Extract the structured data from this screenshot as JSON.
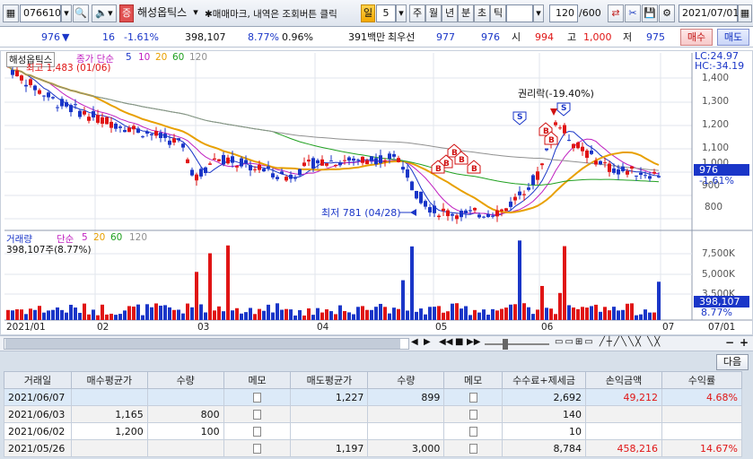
{
  "toolbar": {
    "code": "076610",
    "stock_name": "해성옵틱스",
    "hint": "✱매매마크, 내역은 조회버튼 클릭",
    "period_label": "일",
    "period_value": "5",
    "periods": [
      "주",
      "월",
      "년",
      "분",
      "초",
      "틱"
    ],
    "count": "120",
    "count_max": "/600",
    "date": "2021/07/01"
  },
  "quote": {
    "price": "976",
    "arrow": "▼",
    "change": "16",
    "change_pct": "-1.61%",
    "volume": "398,107",
    "turnover": "8.77%",
    "ratio": "0.96%",
    "amount": "391백만",
    "best_label": "최우선",
    "best_ask": "977",
    "best_bid": "976",
    "open_label": "시",
    "open": "994",
    "high_label": "고",
    "high": "1,000",
    "low_label": "저",
    "low": "975",
    "buy_button": "매수",
    "sell_button": "매도"
  },
  "price_panel": {
    "title": "해성옵틱스",
    "ma_label": "종가 단순",
    "ma_periods": [
      "5",
      "10",
      "20",
      "60",
      "120"
    ],
    "high_note": "최고 1,483 (01/06)",
    "low_note": "최저 781 (04/28)",
    "event_note": "권리락(-19.40%)",
    "lc": "LC:24.97",
    "hc": "HC:-34.19",
    "current_price": "976",
    "current_pct": "-1.61%",
    "y_ticks": [
      "1,400",
      "1,300",
      "1,200",
      "1,100",
      "1,000",
      "900",
      "800"
    ],
    "colors": {
      "up": "#e01515",
      "down": "#1a36c8",
      "ma5": "#1a36c8",
      "ma10": "#c020c0",
      "ma20": "#e8a000",
      "ma60": "#20a020",
      "ma120": "#909090"
    }
  },
  "volume_panel": {
    "title": "거래량",
    "ma_label": "단순",
    "ma_periods": [
      "5",
      "20",
      "60",
      "120"
    ],
    "current": "398,107주(8.77%)",
    "y_ticks": [
      "7,500K",
      "5,000K",
      "3,500K"
    ],
    "current_value": "398,107",
    "current_pct": "8.77%"
  },
  "x_axis": {
    "labels": [
      "2021/01",
      "02",
      "03",
      "04",
      "05",
      "06",
      "07"
    ],
    "right_label": "07/01"
  },
  "bottom": {
    "next_button": "다음",
    "columns": [
      "거래일",
      "매수평균가",
      "수량",
      "메모",
      "매도평균가",
      "수량",
      "메모",
      "수수료+제세금",
      "손익금액",
      "수익률"
    ],
    "rows": [
      {
        "date": "2021/06/07",
        "buy_avg": "",
        "buy_qty": "",
        "sell_avg": "1,227",
        "sell_qty": "899",
        "fee": "2,692",
        "pnl": "49,212",
        "rate": "4.68%"
      },
      {
        "date": "2021/06/03",
        "buy_avg": "1,165",
        "buy_qty": "800",
        "sell_avg": "",
        "sell_qty": "",
        "fee": "140",
        "pnl": "",
        "rate": ""
      },
      {
        "date": "2021/06/02",
        "buy_avg": "1,200",
        "buy_qty": "100",
        "sell_avg": "",
        "sell_qty": "",
        "fee": "10",
        "pnl": "",
        "rate": ""
      },
      {
        "date": "2021/05/26",
        "buy_avg": "",
        "buy_qty": "",
        "sell_avg": "1,197",
        "sell_qty": "3,000",
        "fee": "8,784",
        "pnl": "458,216",
        "rate": "14.67%"
      }
    ]
  }
}
